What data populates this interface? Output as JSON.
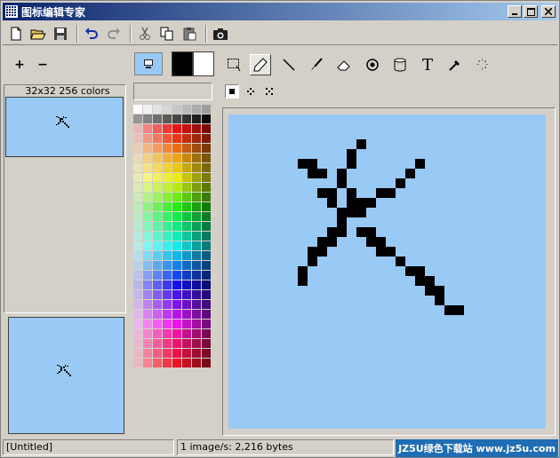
{
  "window": {
    "title": "图标编辑专家",
    "controls": [
      "minimize",
      "maximize",
      "close"
    ]
  },
  "toolbar": {
    "buttons": [
      "new-file",
      "open-folder",
      "save",
      "undo",
      "redo",
      "cut",
      "copy",
      "paste",
      "capture-camera"
    ]
  },
  "zoom": {
    "in_label": "+",
    "out_label": "−"
  },
  "preview": {
    "size_label": "32x32 256 colors"
  },
  "colors": {
    "foreground": "#000000",
    "background": "#ffffff",
    "canvas_bg": "#99c9f5",
    "pixel": "#000000"
  },
  "tools": [
    "select-rect-tool",
    "pencil-tool",
    "line-tool",
    "brush-tool",
    "eraser-tool",
    "fill-tool",
    "bucket-tool",
    "text-tool",
    "eyedropper-tool",
    "spray-tool"
  ],
  "active_tool": "pencil-tool",
  "brush_sizes": [
    "square-small",
    "diamond",
    "cross"
  ],
  "statusbar": {
    "file": "[Untitled]",
    "info": "1 image/s: 2,216 bytes",
    "watermark": "JZ5U绿色下载站 www.jz5u.com"
  }
}
